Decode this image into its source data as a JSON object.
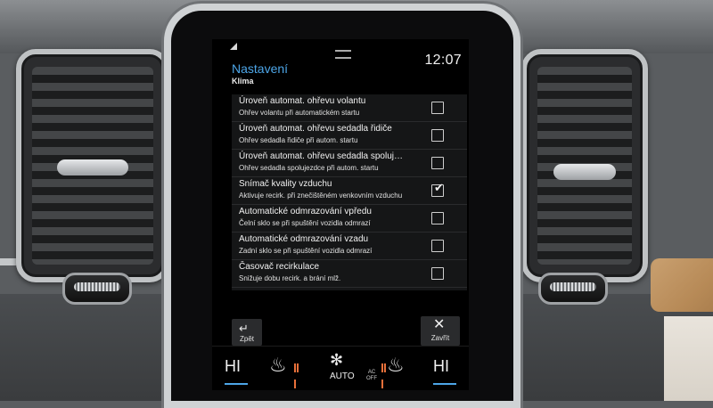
{
  "status_bar": {
    "time": "12:07",
    "signal_icon": "signal-icon",
    "handle_icon": "pull-handle-icon"
  },
  "header": {
    "title": "Nastavení",
    "subtitle": "Klima"
  },
  "settings": [
    {
      "title": "Úroveň automat. ohřevu volantu",
      "description": "Ohřev volantu při automatickém startu",
      "checked": false
    },
    {
      "title": "Úroveň automat. ohřevu sedadla řidiče",
      "description": "Ohřev sedadla řidiče při autom. startu",
      "checked": false
    },
    {
      "title": "Úroveň automat. ohřevu sedadla spoluj…",
      "description": "Ohřev sedadla spolujezdce při autom. startu",
      "checked": false
    },
    {
      "title": "Snímač kvality vzduchu",
      "description": "Aktivuje recirk. při znečištěném venkovním vzduchu",
      "checked": true
    },
    {
      "title": "Automatické odmrazování vpředu",
      "description": "Čelní sklo se při spuštění vozidla odmrazí",
      "checked": false
    },
    {
      "title": "Automatické odmrazování vzadu",
      "description": "Zadní sklo se při spuštění vozidla odmrazí",
      "checked": false
    },
    {
      "title": "Časovač recirkulace",
      "description": "Snižuje dobu recirk. a brání mlž.",
      "checked": false
    }
  ],
  "footer": {
    "back_label": "Zpět",
    "close_label": "Zavřít"
  },
  "climate_bar": {
    "temp_left": "HI",
    "temp_right": "HI",
    "auto_label": "AUTO",
    "ac_label_top": "AC",
    "ac_label_bottom": "OFF",
    "accent_color": "#4da6e8",
    "heat_color": "#e8703a",
    "icons": [
      "seat-heat-icon",
      "fan-icon",
      "seat-heat-icon"
    ]
  }
}
